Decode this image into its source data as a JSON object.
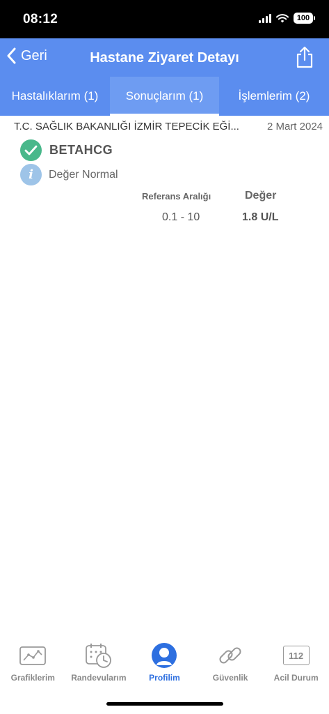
{
  "status_bar": {
    "time": "08:12",
    "battery": "100"
  },
  "nav": {
    "back_label": "Geri",
    "title": "Hastane Ziyaret Detayı"
  },
  "tabs": [
    {
      "label": "Hastalıklarım (1)",
      "active": false
    },
    {
      "label": "Sonuçlarım (1)",
      "active": true
    },
    {
      "label": "İşlemlerim (2)",
      "active": false
    }
  ],
  "visit": {
    "hospital": "T.C. SAĞLIK BAKANLIĞI İZMİR TEPECİK EĞİ...",
    "date": "2 Mart 2024"
  },
  "result": {
    "test_name": "BETAHCG",
    "status": "Değer Normal",
    "ref_header": "Referans Aralığı",
    "value_header": "Değer",
    "ref_range": "0.1 - 10",
    "value": "1.8 U/L"
  },
  "bottom_tabs": [
    {
      "label": "Grafiklerim",
      "icon": "chart-icon"
    },
    {
      "label": "Randevularım",
      "icon": "calendar-clock-icon"
    },
    {
      "label": "Profilim",
      "icon": "profile-icon"
    },
    {
      "label": "Güvenlik",
      "icon": "link-icon"
    },
    {
      "label": "Acil Durum",
      "icon": "emergency-112-icon",
      "icon_text": "112"
    }
  ],
  "colors": {
    "header": "#5b8def",
    "active_tab": "#2d6fe0",
    "check": "#49b88b",
    "info": "#9ec4e8"
  }
}
